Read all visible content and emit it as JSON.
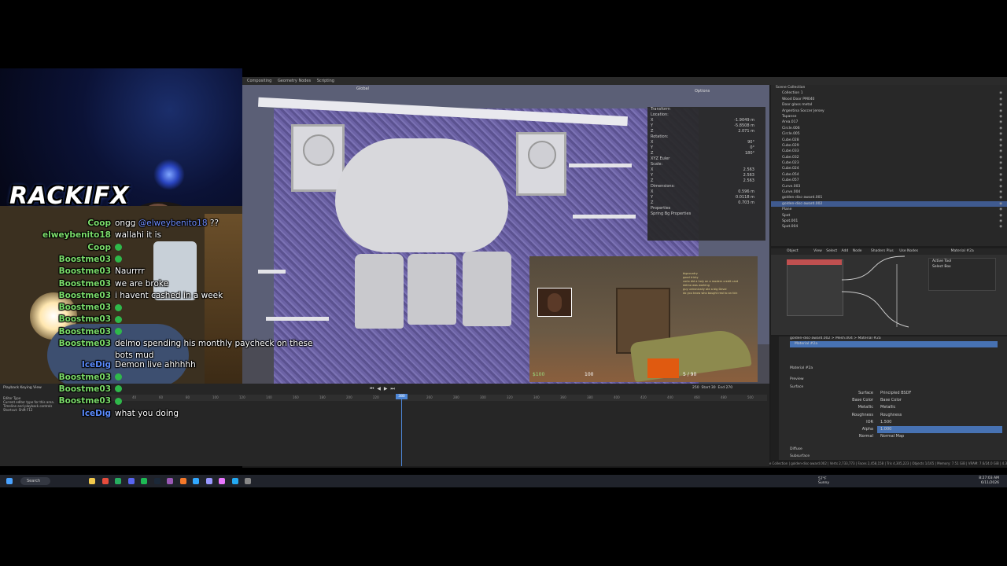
{
  "colors": {
    "chat_user_green": "#7bdc6a",
    "chat_user_blue": "#5b8cff",
    "blender_accent": "#4772b3",
    "viewport_wall": "#6c62a5"
  },
  "overlay": {
    "logo_text": "RACKIFX"
  },
  "chat": [
    {
      "user": "Coop",
      "text": "ongg",
      "mention": "@elweybenito18",
      "suffix": "??",
      "color": "#7bdc6a",
      "emote": false
    },
    {
      "user": "elweybenito18",
      "text": "wallahi it is",
      "color": "#7bdc6a",
      "emote": false
    },
    {
      "user": "Coop",
      "text": "",
      "color": "#7bdc6a",
      "emote": true
    },
    {
      "user": "Boostme03",
      "text": "",
      "color": "#7bdc6a",
      "emote": true
    },
    {
      "user": "Boostme03",
      "text": "Naurrrr",
      "color": "#7bdc6a",
      "emote": false
    },
    {
      "user": "Boostme03",
      "text": "we are broke",
      "color": "#7bdc6a",
      "emote": false
    },
    {
      "user": "Boostme03",
      "text": "i havent cashed in a week",
      "color": "#7bdc6a",
      "emote": false
    },
    {
      "user": "Boostme03",
      "text": "",
      "color": "#7bdc6a",
      "emote": true
    },
    {
      "user": "Boostme03",
      "text": "",
      "color": "#7bdc6a",
      "emote": true
    },
    {
      "user": "Boostme03",
      "text": "",
      "color": "#7bdc6a",
      "emote": true
    },
    {
      "user": "Boostme03",
      "text": "delmo spending his monthly paycheck on these",
      "text2": "bots mud",
      "color": "#7bdc6a",
      "emote": false
    },
    {
      "user": "IceDig",
      "text": "Demon live ahhhhh",
      "color": "#5b8cff",
      "emote": false
    },
    {
      "user": "Boostme03",
      "text": "",
      "color": "#7bdc6a",
      "emote": true
    },
    {
      "user": "Boostme03",
      "text": "",
      "color": "#7bdc6a",
      "emote": true
    },
    {
      "user": "Boostme03",
      "text": "",
      "color": "#7bdc6a",
      "emote": true
    },
    {
      "user": "IceDig",
      "text": "what you doing",
      "color": "#5b8cff",
      "emote": false
    }
  ],
  "blender": {
    "workspace_tabs": [
      "Compositing",
      "Geometry Nodes",
      "Scripting"
    ],
    "viewport": {
      "mode": "Global",
      "options_label": "Options"
    },
    "transform_panel": {
      "title": "Transform",
      "location_label": "Location:",
      "location": {
        "x": "-1.9049 m",
        "y": "-5.8508 m",
        "z": "2.071 m"
      },
      "rotation_label": "Rotation:",
      "rotation": {
        "x": "90°",
        "y": "0°",
        "z": "180°"
      },
      "rotation_mode": "XYZ Euler",
      "scale_label": "Scale:",
      "scale": {
        "x": "2.563",
        "y": "2.563",
        "z": "2.563"
      },
      "dimensions_label": "Dimensions:",
      "dimensions": {
        "x": "0.596 m",
        "y": "0.0118 m",
        "z": "0.703 m"
      },
      "properties_label": "Properties",
      "spring_label": "Spring Bg Properties"
    },
    "outliner": {
      "title": "Scene Collection",
      "items": [
        {
          "name": "Collection 1",
          "selected": false
        },
        {
          "name": "Wood Door PM040",
          "selected": false
        },
        {
          "name": "Door glass metal",
          "selected": false
        },
        {
          "name": "Argentina Soccer Jersey",
          "selected": false
        },
        {
          "name": "Tapanse",
          "selected": false
        },
        {
          "name": "Area.017",
          "selected": false
        },
        {
          "name": "Circle.006",
          "selected": false
        },
        {
          "name": "Circle.005",
          "selected": false
        },
        {
          "name": "Cube.028",
          "selected": false
        },
        {
          "name": "Cube.029",
          "selected": false
        },
        {
          "name": "Cube.033",
          "selected": false
        },
        {
          "name": "Cube.032",
          "selected": false
        },
        {
          "name": "Cube.023",
          "selected": false
        },
        {
          "name": "Cube.024",
          "selected": false
        },
        {
          "name": "Cube.054",
          "selected": false
        },
        {
          "name": "Cube.057",
          "selected": false
        },
        {
          "name": "Curve.003",
          "selected": false
        },
        {
          "name": "Curve.004",
          "selected": false
        },
        {
          "name": "golden-disc-award.001",
          "selected": false
        },
        {
          "name": "golden-disc-award.002",
          "selected": true
        },
        {
          "name": "Plane",
          "selected": false
        },
        {
          "name": "Spot",
          "selected": false
        },
        {
          "name": "Spot.001",
          "selected": false
        },
        {
          "name": "Spot.004",
          "selected": false
        }
      ]
    },
    "node_editor": {
      "object_label": "Object",
      "menus": [
        "View",
        "Select",
        "Add",
        "Node"
      ],
      "shader_label": "Shaders Plus",
      "use_nodes": "Use Nodes",
      "material": "Material #2a",
      "active_tool": "Active Tool",
      "select_box": "Select Box"
    },
    "properties": {
      "breadcrumb": [
        "golden-disc-award.002",
        "Mesh.004",
        "Material #2a"
      ],
      "material_slot": "Material #2a",
      "material_name": "Material #2a",
      "preview_label": "Preview",
      "surface_section": "Surface",
      "rows": [
        {
          "label": "Surface",
          "value": "Principled BSDF",
          "bar": false
        },
        {
          "label": "Base Color",
          "value": "Base Color",
          "bar": false
        },
        {
          "label": "Metallic",
          "value": "Metallic",
          "bar": false
        },
        {
          "label": "Roughness",
          "value": "Roughness",
          "bar": false
        },
        {
          "label": "IOR",
          "value": "1.500",
          "bar": false
        },
        {
          "label": "Alpha",
          "value": "1.000",
          "bar": true
        },
        {
          "label": "Normal",
          "value": "Normal Map",
          "bar": false
        }
      ],
      "diffuse_label": "Diffuse",
      "subsurface_label": "Subsurface"
    },
    "timeline": {
      "menus": [
        "Playback",
        "Keying",
        "View"
      ],
      "frame_current": "380",
      "ruler_ticks": [
        "20",
        "40",
        "60",
        "80",
        "100",
        "120",
        "140",
        "160",
        "180",
        "200",
        "220",
        "240",
        "260",
        "280",
        "300",
        "320",
        "340",
        "360",
        "380",
        "400",
        "420",
        "440",
        "460",
        "480",
        "500"
      ],
      "start_label": "Start",
      "start": "30",
      "end_label": "End",
      "end": "270",
      "current_right": "250",
      "tooltip_title": "Editor Type",
      "tooltip_lines": [
        "Current editor type for this area.",
        "Timeline and playback controls",
        "Shortcut: Shift F12"
      ]
    },
    "status_bar": "Scene Collection | golden-disc-award.002 | Verts 2,733,773 | Faces 2,458,158 | Tris 4,305,223 | Objects 1/165 | Memory: 7.51 GiB | VRAM: 7.6/24.0 GiB | 4.3"
  },
  "game_overlay": {
    "money": "$100",
    "ammo": "100",
    "hp": "5 / 90",
    "chat_lines": [
      "bigcountry",
      "good tricky",
      "carlo did a holy on a modern credit card",
      "delmo was working",
      "guy unironically ate a big Devol",
      "do you know who bought real to an tick"
    ]
  },
  "taskbar": {
    "search_label": "Search",
    "weather_temp": "57°F",
    "weather_desc": "Sunny",
    "time": "8:27:03 AM",
    "date": "6/11/2026",
    "icons": [
      "start-icon",
      "search-icon",
      "taskview-icon",
      "files-icon",
      "chrome-icon",
      "discord-icon",
      "spotify-icon",
      "steam-icon",
      "obs-icon",
      "blender-icon",
      "photoshop-icon",
      "ae-icon",
      "premiere-icon",
      "vscode-icon",
      "terminal-icon"
    ]
  }
}
